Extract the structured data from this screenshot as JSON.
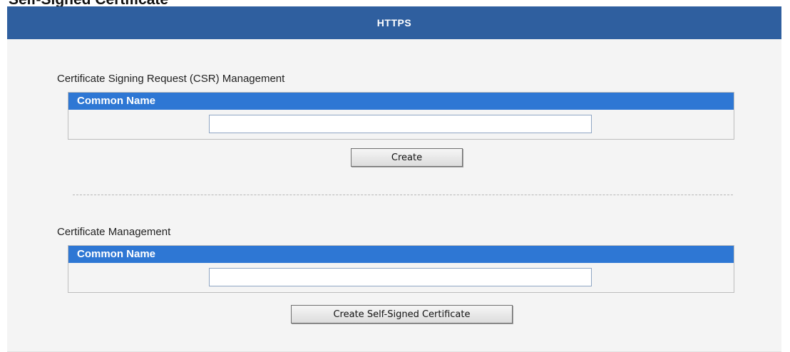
{
  "page": {
    "heading": "Self-Signed Certificate"
  },
  "panel": {
    "title": "HTTPS"
  },
  "csr": {
    "title": "Certificate Signing Request (CSR) Management",
    "column_header": "Common Name",
    "common_name_value": "",
    "button_label": "Create"
  },
  "cert": {
    "title": "Certificate Management",
    "column_header": "Common Name",
    "common_name_value": "",
    "button_label": "Create Self-Signed Certificate"
  },
  "colors": {
    "panel_header": "#2f5f9f",
    "table_header": "#2e77d4",
    "panel_background": "#f4f4f4"
  }
}
